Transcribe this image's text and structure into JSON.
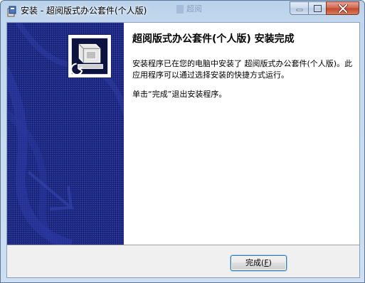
{
  "window": {
    "title": "安装 - 超阅版式办公套件(个人版)",
    "background_tab_label": "超阅"
  },
  "content": {
    "heading": "超阅版式办公套件(个人版) 安装完成",
    "body": "安装程序已在您的电脑中安装了 超阅版式办公套件(个人版)。此应用程序可以通过选择安装的快捷方式运行。",
    "instruction": "单击“完成”退出安装程序。"
  },
  "buttons": {
    "finish_label": "完成",
    "finish_accel_prefix": "(",
    "finish_accel_key": "F",
    "finish_accel_suffix": ")"
  },
  "colors": {
    "sidebar": "#1b2580",
    "title_bar": "#c3d8ee",
    "close_button": "#c2472a"
  },
  "icons": {
    "title_icon": "installer-icon",
    "app_logo": "setup-computer-icon",
    "minimize": "minimize-icon",
    "maximize": "maximize-icon",
    "close": "close-icon"
  }
}
